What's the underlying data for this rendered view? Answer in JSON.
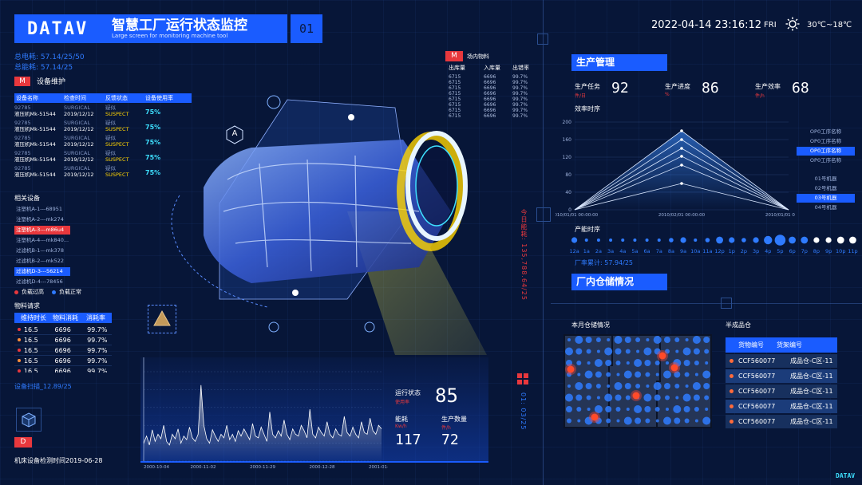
{
  "brand": {
    "logo": "DATAV",
    "title": "智慧工厂运行状态监控",
    "subtitle": "Large screen for monitoring machine tool",
    "page_no": "01"
  },
  "header": {
    "datetime": "2022-04-14 23:16:12",
    "weekday": "FRI",
    "temp": "30℃~18℃"
  },
  "power": {
    "total_power": "总电耗: 57.14/25/50",
    "total_energy": "总能耗: 57.14/25"
  },
  "maint": {
    "tag": "M",
    "title": "设备维护",
    "cols": [
      "设备名称",
      "检查时间",
      "反馈状态",
      "设备使用率"
    ],
    "rows": [
      {
        "code": "92785",
        "name": "液压机Mk-51544",
        "type": "SURGICAL",
        "date": "2019/12/12",
        "s1": "疑似",
        "s2": "SUSPECT",
        "rate": "75%"
      },
      {
        "code": "92785",
        "name": "液压机Mk-51544",
        "type": "SURGICAL",
        "date": "2019/12/12",
        "s1": "疑似",
        "s2": "SUSPECT",
        "rate": "75%"
      },
      {
        "code": "92785",
        "name": "液压机Mk-51544",
        "type": "SURGICAL",
        "date": "2019/12/12",
        "s1": "疑似",
        "s2": "SUSPECT",
        "rate": "75%"
      },
      {
        "code": "92785",
        "name": "液压机Mk-51544",
        "type": "SURGICAL",
        "date": "2019/12/12",
        "s1": "疑似",
        "s2": "SUSPECT",
        "rate": "75%"
      },
      {
        "code": "92785",
        "name": "液压机Mk-51544",
        "type": "SURGICAL",
        "date": "2019/12/12",
        "s1": "疑似",
        "s2": "SUSPECT",
        "rate": "75%"
      }
    ]
  },
  "related": {
    "title": "相关设备",
    "items": [
      "注塑机A-1---68951",
      "注塑机A-2---mk274",
      "注塑机A-3---m86u4",
      "注塑机A-4---mk840...",
      "过滤机B-1---mk378",
      "过滤机B-2---mk522",
      "过滤机D-3---56214",
      "过滤机D-4---78456"
    ],
    "legend_over": "负载过高",
    "legend_normal": "负载正常"
  },
  "material": {
    "title": "物料请求",
    "cols": [
      "维持时长",
      "物料消耗",
      "消耗率"
    ],
    "rows": [
      {
        "a": "16.5",
        "b": "6696",
        "c": "99.7%"
      },
      {
        "a": "16.5",
        "b": "6696",
        "c": "99.7%"
      },
      {
        "a": "16.5",
        "b": "6696",
        "c": "99.7%"
      },
      {
        "a": "16.5",
        "b": "6696",
        "c": "99.7%"
      },
      {
        "a": "16.5",
        "b": "6696",
        "c": "99.7%"
      },
      {
        "a": "16.5",
        "b": "6696",
        "c": "99.7%"
      }
    ]
  },
  "scan": "设备扫描_12.89/25",
  "bottom_left": {
    "tag": "D",
    "date": "机床设备检测时间2019-06-28"
  },
  "site_material": {
    "tag": "M",
    "title": "场内物料",
    "cols": [
      "出库量",
      "入库量",
      "出错率"
    ],
    "rows": [
      {
        "a": "6715",
        "b": "6696",
        "c": "99.7%"
      },
      {
        "a": "6715",
        "b": "6696",
        "c": "99.7%"
      },
      {
        "a": "6715",
        "b": "6696",
        "c": "99.7%"
      },
      {
        "a": "6715",
        "b": "6696",
        "c": "99.7%"
      },
      {
        "a": "6715",
        "b": "6696",
        "c": "99.7%"
      },
      {
        "a": "6715",
        "b": "6696",
        "c": "99.7%"
      },
      {
        "a": "6715",
        "b": "6696",
        "c": "99.7%"
      },
      {
        "a": "6715",
        "b": "6696",
        "c": "99.7%"
      }
    ]
  },
  "vertical": {
    "today_energy": "今日能耗: 135,788.64/25",
    "ratio": "01: 03/25"
  },
  "engine_markers": {
    "a": "A"
  },
  "running": {
    "status_label": "运行状态",
    "status_sub": "使用率",
    "status_value": "85",
    "energy_label": "能耗",
    "energy_unit": "Kw/h",
    "energy_value": "117",
    "output_label": "生产数量",
    "output_unit": "件/h",
    "output_value": "72"
  },
  "production": {
    "title": "生产管理",
    "kpis": [
      {
        "label": "生产任务",
        "unit": "件/日",
        "value": "92"
      },
      {
        "label": "生产进度",
        "unit": "%",
        "value": "86"
      },
      {
        "label": "生产效率",
        "unit": "件/h",
        "value": "68"
      }
    ],
    "efficiency_title": "效率时序",
    "proc_list": [
      "OP0工序名称",
      "OP0工序名称",
      "OP0工序名称",
      "OP0工序名称"
    ],
    "machine_list": [
      "01号机器",
      "02号机器",
      "03号机器",
      "04号机器"
    ],
    "capacity_title": "产能时序",
    "hours": [
      "12a",
      "1a",
      "2a",
      "3a",
      "4a",
      "5a",
      "6a",
      "7a",
      "8a",
      "9a",
      "10a",
      "11a",
      "12p",
      "1p",
      "2p",
      "3p",
      "4p",
      "5p",
      "6p",
      "7p",
      "8p",
      "9p",
      "10p",
      "11p"
    ],
    "accum": "厂率累计: 57.94/25"
  },
  "warehouse": {
    "title": "厂内仓储情况",
    "map_title": "本月仓储情况",
    "semi_title": "半成品仓",
    "cols": [
      "货物编号",
      "货架编号"
    ],
    "rows": [
      {
        "a": "CCF560077",
        "b": "成品仓-C区-11"
      },
      {
        "a": "CCF560077",
        "b": "成品仓-C区-11"
      },
      {
        "a": "CCF560077",
        "b": "成品仓-C区-11"
      },
      {
        "a": "CCF560077",
        "b": "成品仓-C区-11"
      },
      {
        "a": "CCF560077",
        "b": "成品仓-C区-11"
      }
    ]
  },
  "footer_logo": "DATAV",
  "colors": {
    "accent": "#1a5cff",
    "alert": "#e8383d",
    "warn": "#ffd400",
    "cyan": "#3ee0ff"
  },
  "chart_data": [
    {
      "type": "line",
      "title": "效率时序",
      "x": [
        "2010/01/01 00:00:00",
        "2010/02/01 00:00:00",
        "2010/01/01 00:00:00"
      ],
      "ylim": [
        0,
        200
      ],
      "yticks": [
        0,
        40,
        80,
        120,
        160,
        200
      ],
      "series": [
        {
          "values": [
            0,
            180,
            0
          ]
        },
        {
          "values": [
            0,
            160,
            0
          ]
        },
        {
          "values": [
            0,
            140,
            0
          ]
        },
        {
          "values": [
            0,
            122,
            0
          ]
        },
        {
          "values": [
            0,
            102,
            0
          ]
        },
        {
          "values": [
            0,
            60,
            0
          ]
        }
      ]
    },
    {
      "type": "scatter",
      "title": "产能时序",
      "x": [
        "12a",
        "1a",
        "2a",
        "3a",
        "4a",
        "5a",
        "6a",
        "7a",
        "8a",
        "9a",
        "10a",
        "11a",
        "12p",
        "1p",
        "2p",
        "3p",
        "4p",
        "5p",
        "6p",
        "7p",
        "8p",
        "9p",
        "10p",
        "11p"
      ],
      "values": [
        3,
        1,
        1,
        1,
        1,
        1,
        1,
        1,
        2,
        3,
        1,
        2,
        4,
        3,
        2,
        3,
        5,
        7,
        4,
        4,
        3,
        3,
        4,
        4
      ]
    },
    {
      "type": "area",
      "x": [
        "2000-10-04",
        "2000-11-02",
        "2000-11-29",
        "2000-12-28",
        "2001-01-25"
      ],
      "values": [
        20,
        28,
        18,
        35,
        22,
        30,
        25,
        40,
        22,
        18,
        30,
        25,
        36,
        20,
        28,
        24,
        38,
        26,
        22,
        30,
        85,
        40,
        25,
        20,
        35,
        28,
        22,
        30,
        26,
        40,
        24,
        30,
        22,
        34,
        28,
        36,
        30,
        24,
        42,
        28,
        26,
        38,
        30,
        22,
        55,
        30,
        26,
        34,
        28,
        46,
        30,
        24,
        36,
        30,
        28,
        40,
        34,
        26,
        58,
        30,
        26,
        38,
        32,
        28,
        44,
        30,
        26,
        36,
        30,
        28,
        50,
        32,
        28,
        38,
        30,
        26,
        44,
        32,
        30,
        48,
        34,
        30,
        40,
        36
      ]
    }
  ]
}
